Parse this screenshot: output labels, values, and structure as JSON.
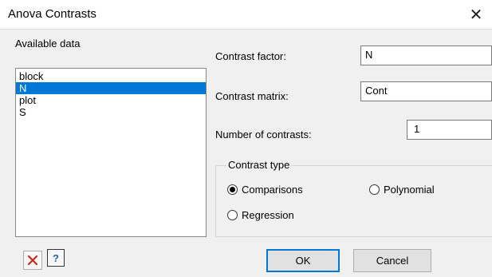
{
  "window": {
    "title": "Anova Contrasts",
    "close_glyph": "✕"
  },
  "available_data": {
    "label": "Available data",
    "items": [
      "block",
      "N",
      "plot",
      "S"
    ],
    "selected": "N"
  },
  "fields": {
    "contrast_factor": {
      "label": "Contrast factor:",
      "value": "N"
    },
    "contrast_matrix": {
      "label": "Contrast matrix:",
      "value": "Cont"
    },
    "number_of_contrasts": {
      "label": "Number of contrasts:",
      "value": "1"
    }
  },
  "contrast_type": {
    "label": "Contrast type",
    "options": [
      {
        "label": "Comparisons",
        "checked": true
      },
      {
        "label": "Polynomial",
        "checked": false
      },
      {
        "label": "Regression",
        "checked": false
      }
    ]
  },
  "buttons": {
    "ok": "OK",
    "cancel": "Cancel",
    "clear_icon": "x-icon",
    "help_icon": "help-icon",
    "help_glyph": "?"
  },
  "colors": {
    "selection": "#0078d7",
    "clear_icon": "#c42b1c",
    "help_icon": "#2266aa"
  }
}
